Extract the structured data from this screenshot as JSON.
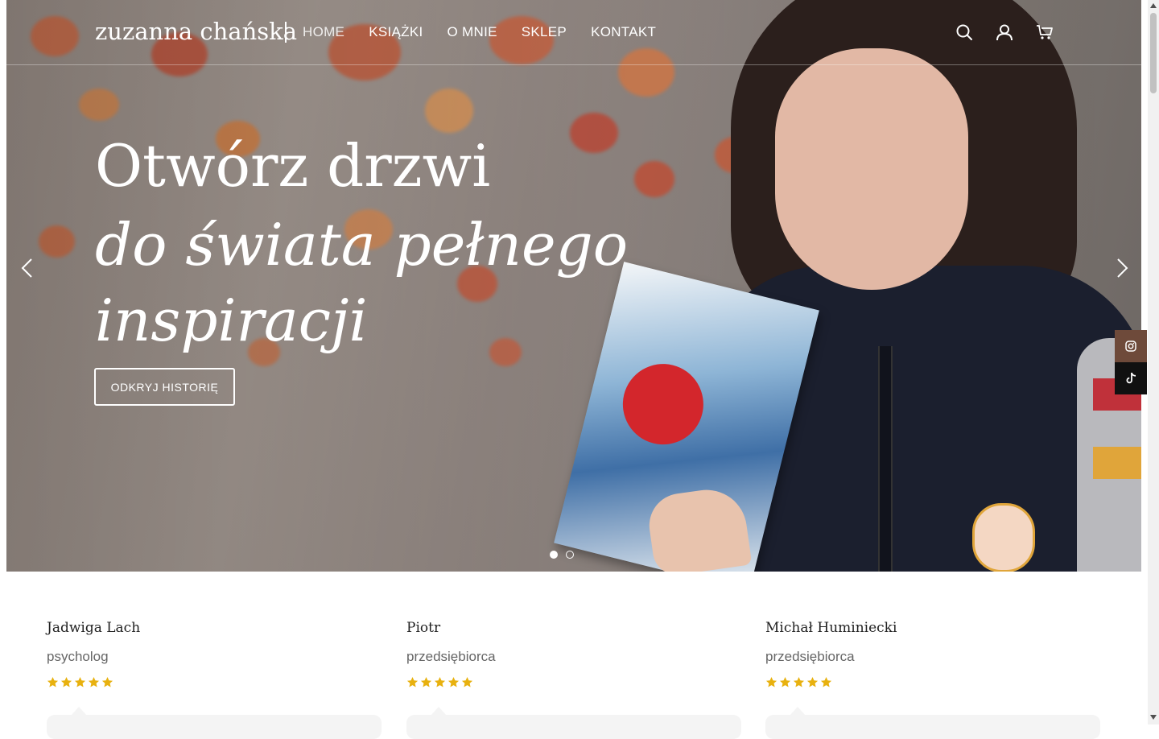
{
  "header": {
    "logo": "zuzanna chańska",
    "nav": [
      "HOME",
      "KSIĄŻKI",
      "O MNIE",
      "SKLEP",
      "KONTAKT"
    ],
    "icons": [
      "search-icon",
      "user-icon",
      "cart-icon"
    ]
  },
  "hero": {
    "line1": "Otwórz drzwi",
    "line2": "do świata pełnego",
    "line3": "inspiracji",
    "cta": "ODKRYJ HISTORIĘ",
    "slide_count": 2,
    "active_slide": 1
  },
  "social": [
    "instagram-icon",
    "tiktok-icon"
  ],
  "testimonials": [
    {
      "name": "Jadwiga Lach",
      "role": "psycholog",
      "rating": 5
    },
    {
      "name": "Piotr",
      "role": "przedsiębiorca",
      "rating": 5
    },
    {
      "name": "Michał Huminiecki",
      "role": "przedsiębiorca",
      "rating": 5
    }
  ],
  "colors": {
    "star": "#e8b10f",
    "instagram_bg": "#6e4a3a",
    "tiktok_bg": "#111111",
    "card_bg": "#f4f4f4"
  }
}
